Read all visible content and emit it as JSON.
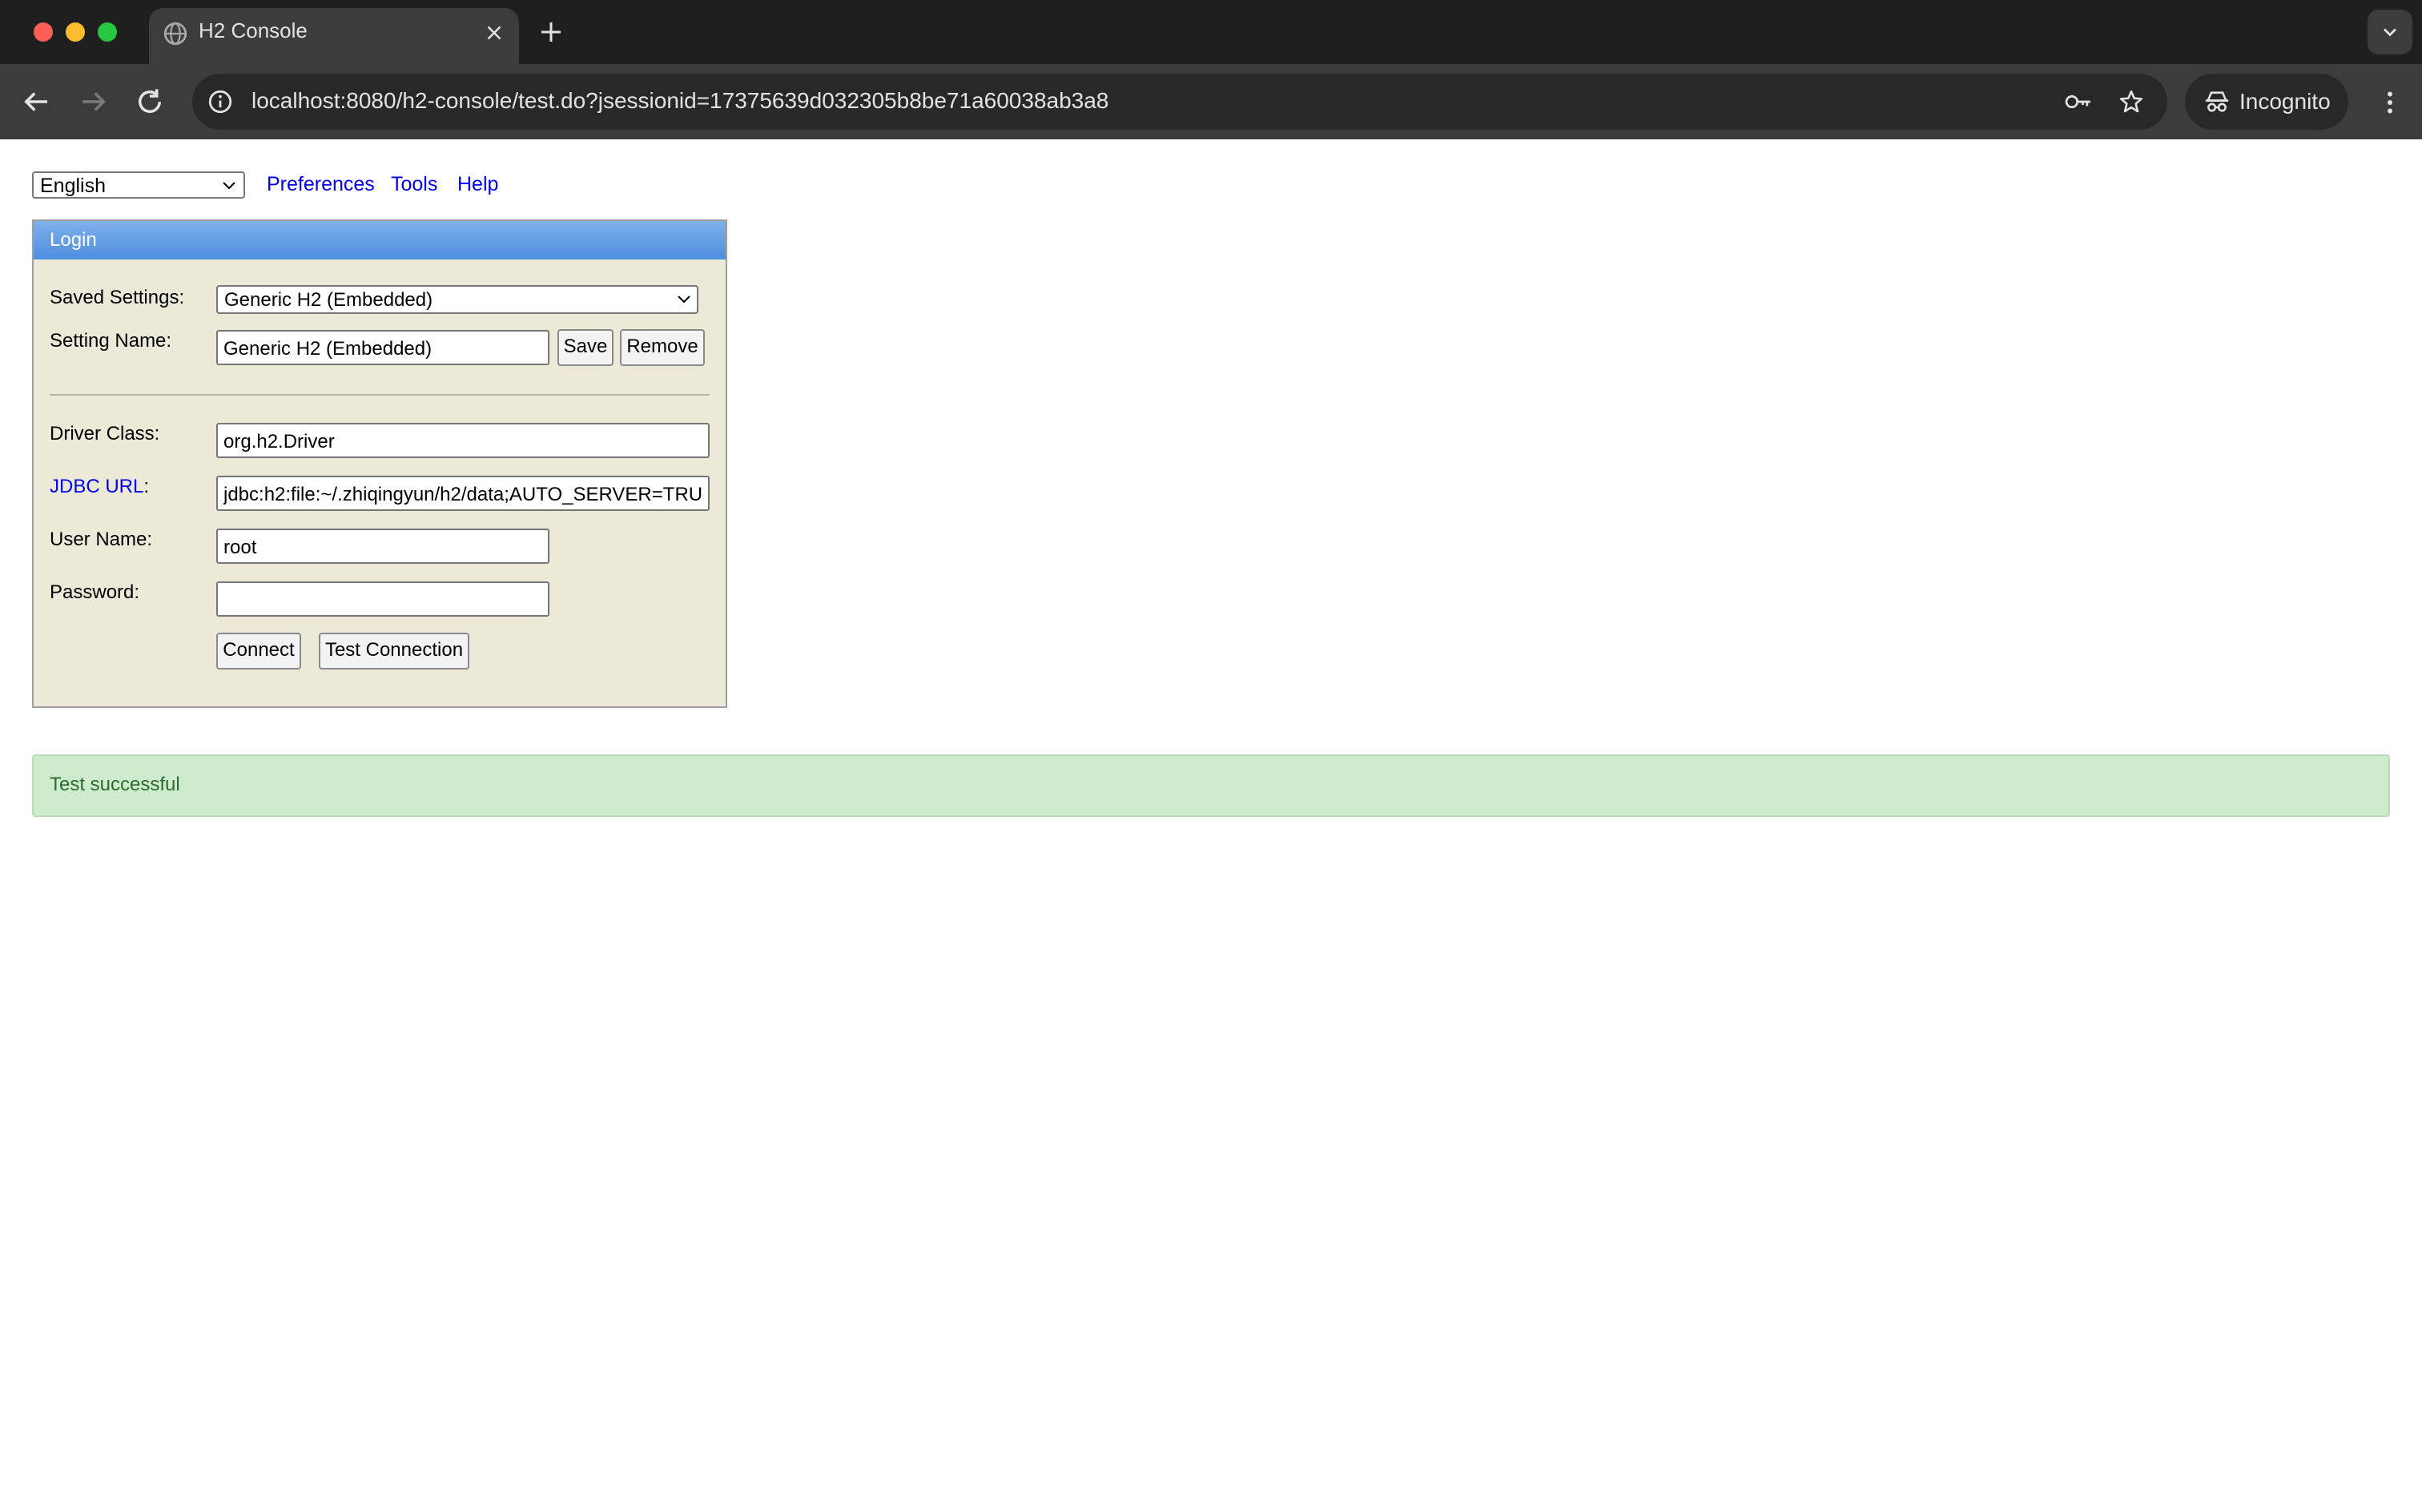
{
  "browser": {
    "tab_title": "H2 Console",
    "url": "localhost:8080/h2-console/test.do?jsessionid=17375639d032305b8be71a60038ab3a8",
    "incognito_label": "Incognito"
  },
  "topbar": {
    "language": "English",
    "links": [
      "Preferences",
      "Tools",
      "Help"
    ]
  },
  "login": {
    "title": "Login",
    "saved_settings_label": "Saved Settings:",
    "saved_settings_value": "Generic H2 (Embedded)",
    "setting_name_label": "Setting Name:",
    "setting_name_value": "Generic H2 (Embedded)",
    "save_label": "Save",
    "remove_label": "Remove",
    "driver_class_label": "Driver Class:",
    "driver_class_value": "org.h2.Driver",
    "jdbc_url_link": "JDBC URL",
    "jdbc_url_colon": ":",
    "jdbc_url_value": "jdbc:h2:file:~/.zhiqingyun/h2/data;AUTO_SERVER=TRU",
    "user_name_label": "User Name:",
    "user_name_value": "root",
    "password_label": "Password:",
    "password_value": "",
    "connect_label": "Connect",
    "test_connection_label": "Test Connection"
  },
  "status": {
    "message": "Test successful",
    "color": "#cdebcd"
  }
}
